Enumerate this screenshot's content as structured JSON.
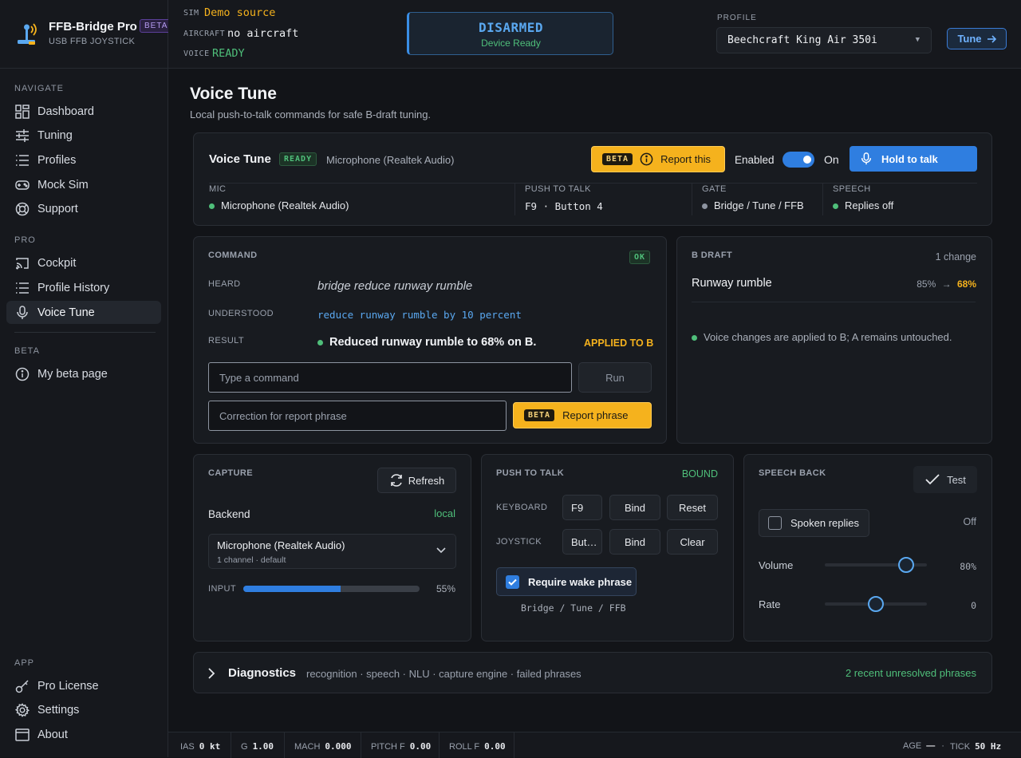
{
  "brand": {
    "name": "FFB-Bridge Pro",
    "badge": "BETA",
    "subtitle": "USB FFB JOYSTICK"
  },
  "topbar": {
    "sim_label": "SIM",
    "sim_value": "Demo source",
    "aircraft_label": "AIRCRAFT",
    "aircraft_value": "no aircraft",
    "voice_label": "VOICE",
    "voice_value": "READY",
    "arm_state": "DISARMED",
    "arm_sub": "Device Ready",
    "profile_label": "PROFILE",
    "profile_value": "Beechcraft King Air 350i",
    "tune_label": "Tune"
  },
  "sidebar": {
    "sections": [
      {
        "title": "NAVIGATE",
        "items": [
          {
            "label": "Dashboard",
            "icon": "grid-icon"
          },
          {
            "label": "Tuning",
            "icon": "sliders-icon"
          },
          {
            "label": "Profiles",
            "icon": "list-icon"
          },
          {
            "label": "Mock Sim",
            "icon": "gamepad-icon"
          },
          {
            "label": "Support",
            "icon": "lifebuoy-icon"
          }
        ]
      },
      {
        "title": "PRO",
        "items": [
          {
            "label": "Cockpit",
            "icon": "cast-icon"
          },
          {
            "label": "Profile History",
            "icon": "list-icon"
          },
          {
            "label": "Voice Tune",
            "icon": "mic-icon",
            "active": true
          }
        ]
      },
      {
        "title": "BETA",
        "items": [
          {
            "label": "My beta page",
            "icon": "info-icon"
          }
        ]
      },
      {
        "title": "APP",
        "items": [
          {
            "label": "Pro License",
            "icon": "key-icon"
          },
          {
            "label": "Settings",
            "icon": "gear-icon"
          },
          {
            "label": "About",
            "icon": "window-icon"
          }
        ]
      }
    ]
  },
  "page": {
    "title": "Voice Tune",
    "subtitle": "Local push-to-talk commands for safe B-draft tuning."
  },
  "voice_card": {
    "title": "Voice Tune",
    "status": "READY",
    "device": "Microphone (Realtek Audio)",
    "beta_badge": "BETA",
    "report_label": "Report this",
    "enabled_label": "Enabled",
    "toggle_state": "On",
    "talk_label": "Hold to talk",
    "mic_label": "MIC",
    "mic_value": "Microphone (Realtek Audio)",
    "ptt_label": "PUSH TO TALK",
    "ptt_value": "F9 · Button 4",
    "gate_label": "GATE",
    "gate_value": "Bridge / Tune / FFB",
    "speech_label": "SPEECH",
    "speech_value": "Replies off"
  },
  "command": {
    "title": "COMMAND",
    "status": "OK",
    "heard_label": "HEARD",
    "heard_value": "bridge reduce runway rumble",
    "understood_label": "UNDERSTOOD",
    "understood_value": "reduce runway rumble by 10 percent",
    "result_label": "RESULT",
    "result_value": "Reduced runway rumble to 68% on B.",
    "result_tag": "APPLIED TO B",
    "command_placeholder": "Type a command",
    "run_label": "Run",
    "correction_placeholder": "Correction for report phrase",
    "beta_badge": "BETA",
    "report_phrase_label": "Report phrase"
  },
  "bdraft": {
    "title": "B DRAFT",
    "count": "1 change",
    "item_name": "Runway rumble",
    "from": "85%",
    "arrow": "→",
    "to": "68%",
    "note": "Voice changes are applied to B; A remains untouched."
  },
  "capture": {
    "title": "CAPTURE",
    "refresh_label": "Refresh",
    "backend_label": "Backend",
    "backend_value": "local",
    "device_name": "Microphone (Realtek Audio)",
    "device_sub": "1 channel · default",
    "input_label": "INPUT",
    "input_value": "55%",
    "input_level": 0.55
  },
  "ptt": {
    "title": "PUSH TO TALK",
    "status": "BOUND",
    "keyboard_label": "KEYBOARD",
    "keyboard_key": "F9",
    "bind_label": "Bind",
    "reset_label": "Reset",
    "joystick_label": "JOYSTICK",
    "joystick_key": "But…",
    "bind2_label": "Bind",
    "clear_label": "Clear",
    "wake_label": "Require wake phrase",
    "wake_phrases": "Bridge / Tune / FFB"
  },
  "speech": {
    "title": "SPEECH BACK",
    "test_label": "Test",
    "spoken_label": "Spoken replies",
    "spoken_state": "Off",
    "volume_label": "Volume",
    "volume_value": "80%",
    "volume_level": 0.8,
    "rate_label": "Rate",
    "rate_value": "0",
    "rate_level": 0.5
  },
  "diagnostics": {
    "title": "Diagnostics",
    "subtitle": "recognition · speech · NLU · capture engine · failed phrases",
    "summary": "2 recent unresolved phrases"
  },
  "statusbar": {
    "ias_label": "IAS",
    "ias_value": "0 kt",
    "g_label": "G",
    "g_value": "1.00",
    "mach_label": "MACH",
    "mach_value": "0.000",
    "pitch_label": "PITCH F",
    "pitch_value": "0.00",
    "roll_label": "ROLL F",
    "roll_value": "0.00",
    "age_label": "AGE",
    "age_value": "—",
    "tick_label": "TICK",
    "tick_value": "50 Hz"
  },
  "colors": {
    "accent": "#3a8ee6",
    "ok": "#4fbf7a",
    "warn": "#f5b21d",
    "beta": "#b69cf2"
  }
}
